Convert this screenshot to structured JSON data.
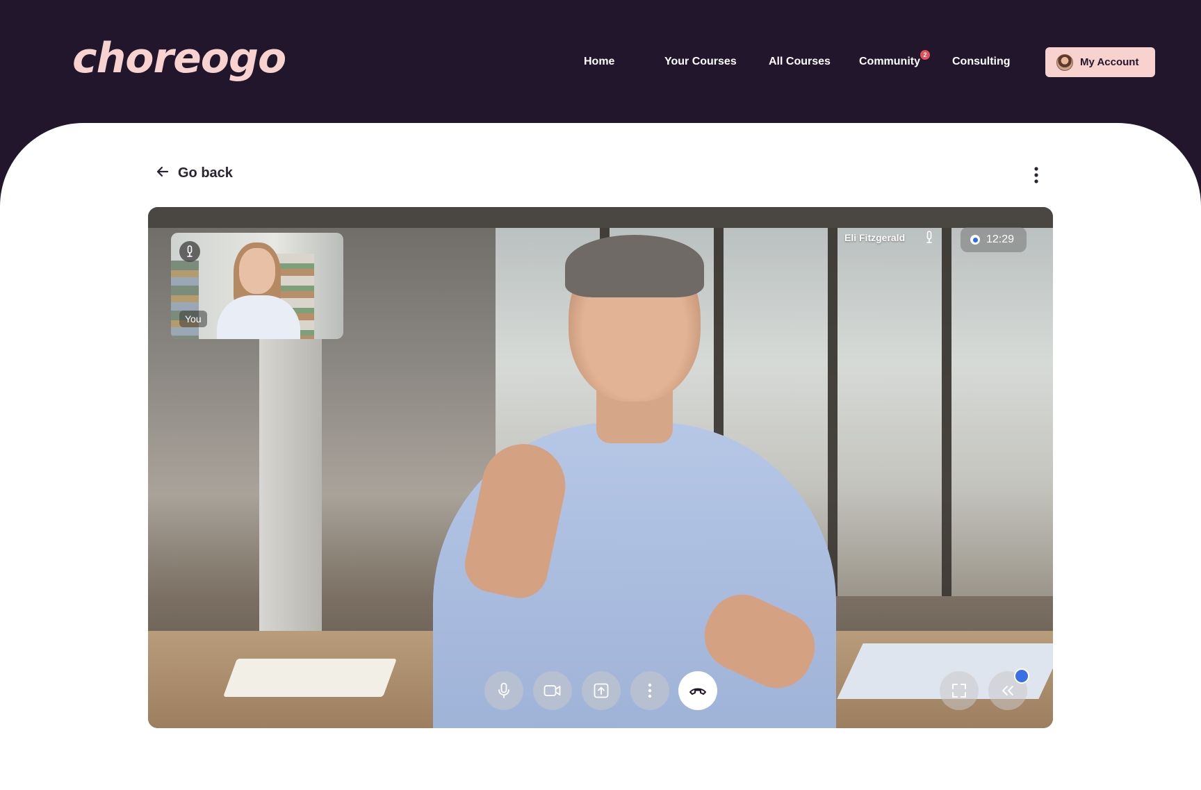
{
  "brand": {
    "logo_text": "choreogo"
  },
  "nav": {
    "items": [
      {
        "label": "Home"
      },
      {
        "label": "Your Courses"
      },
      {
        "label": "All Courses"
      },
      {
        "label": "Community",
        "badge": "2"
      },
      {
        "label": "Consulting"
      }
    ],
    "account_label": "My Account"
  },
  "page": {
    "back_label": "Go back"
  },
  "call": {
    "self_label": "You",
    "remote_participant": "Eli Fitzgerald",
    "elapsed_time": "12:29",
    "recording": true,
    "controls": [
      "microphone",
      "camera",
      "share-screen",
      "more-options",
      "end-call",
      "fullscreen",
      "collapse-panel"
    ]
  },
  "colors": {
    "header_bg": "#22162c",
    "accent_pink": "#f7d2cf",
    "badge_red": "#e0515a",
    "recording_blue": "#2b6fe0"
  }
}
